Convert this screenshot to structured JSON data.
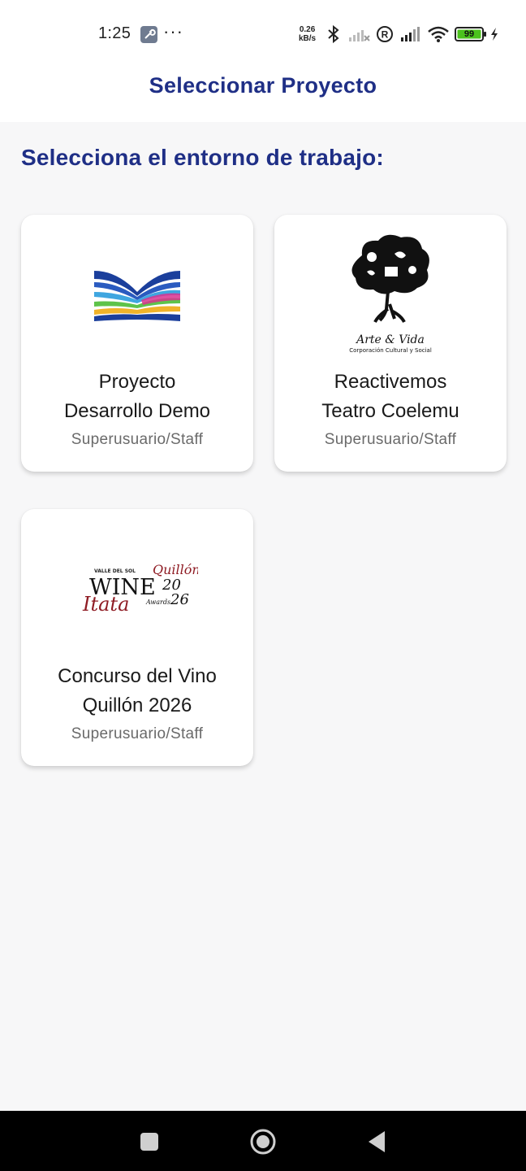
{
  "status_bar": {
    "time": "1:25",
    "dots": "···",
    "speed_value": "0.26",
    "speed_unit": "kB/s",
    "battery": "99",
    "icons": [
      "wrench-icon",
      "bluetooth-icon",
      "no-signal-icon",
      "registered-icon",
      "signal-icon",
      "wifi-icon",
      "battery-icon",
      "charging-icon"
    ]
  },
  "app_bar": {
    "title": "Seleccionar Proyecto"
  },
  "heading": "Selecciona el entorno de trabajo:",
  "projects": [
    {
      "line1": "Proyecto",
      "line2": "Desarrollo Demo",
      "role": "Superusuario/Staff",
      "logo": "ribbon-logo"
    },
    {
      "line1": "Reactivemos",
      "line2": "Teatro Coelemu",
      "role": "Superusuario/Staff",
      "logo": "arte-vida-tree-logo",
      "logo_text": "Arte & Vida",
      "logo_subtext": "Corporación Cultural y Social"
    },
    {
      "line1": "Concurso del Vino",
      "line2": "Quillón 2026",
      "role": "Superusuario/Staff",
      "logo": "wine-awards-logo",
      "logo_text_top": "VALLE DEL SOL",
      "logo_script1": "Quillón",
      "logo_main": "WINE",
      "logo_year1": "20",
      "logo_year2": "26",
      "logo_script2": "Itata",
      "logo_awards": "Awards"
    }
  ],
  "colors": {
    "accent": "#1f2f86",
    "background": "#f7f7f8",
    "card": "#ffffff",
    "nav": "#000000"
  },
  "nav": [
    "square-recents-icon",
    "circle-home-icon",
    "triangle-back-icon"
  ]
}
